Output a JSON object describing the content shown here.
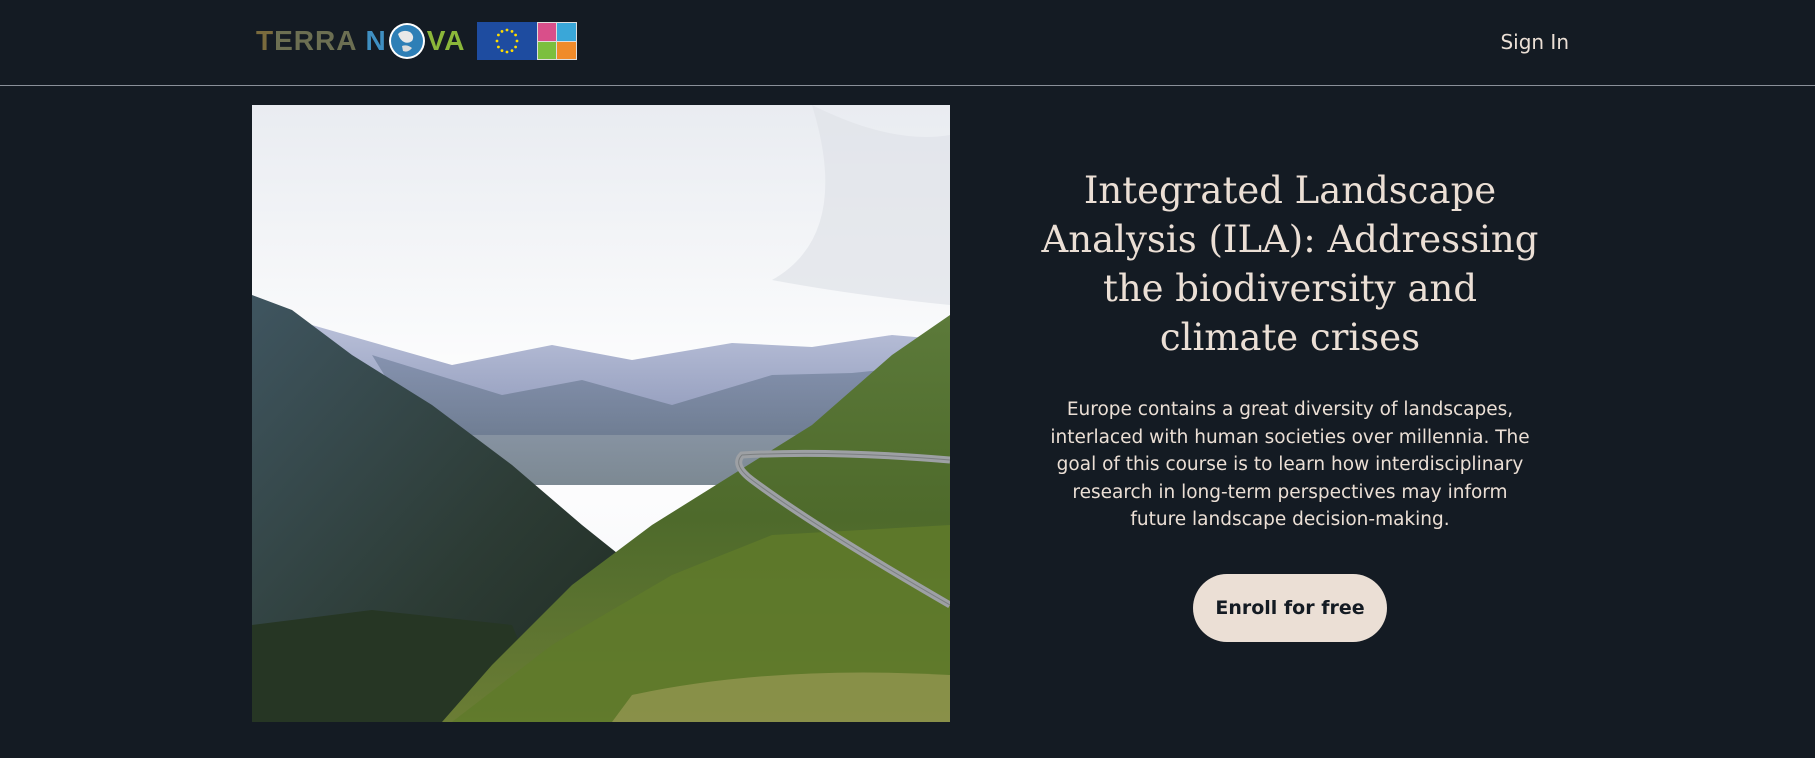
{
  "header": {
    "logo": {
      "letters_before": "TERRA N",
      "letters_after": "VA",
      "colors": [
        "#7a6b3d",
        "#3f8fc1",
        "#8bb73a"
      ]
    },
    "sign_in_label": "Sign In"
  },
  "hero": {
    "image_description_icon": "mountain-road-photo",
    "title": "Integrated Landscape Analysis (ILA): Addressing the biodiversity and climate crises",
    "description": "Europe contains a great diversity of landscapes, interlaced with human societies over millennia. The goal of this course is to learn how interdisciplinary research in long-term perspectives may inform future landscape decision-making.",
    "enroll_label": "Enroll for free"
  },
  "colors": {
    "background": "#141b23",
    "text": "#ebdfd5",
    "button_bg": "#ebdfd5",
    "button_text": "#141b23"
  }
}
